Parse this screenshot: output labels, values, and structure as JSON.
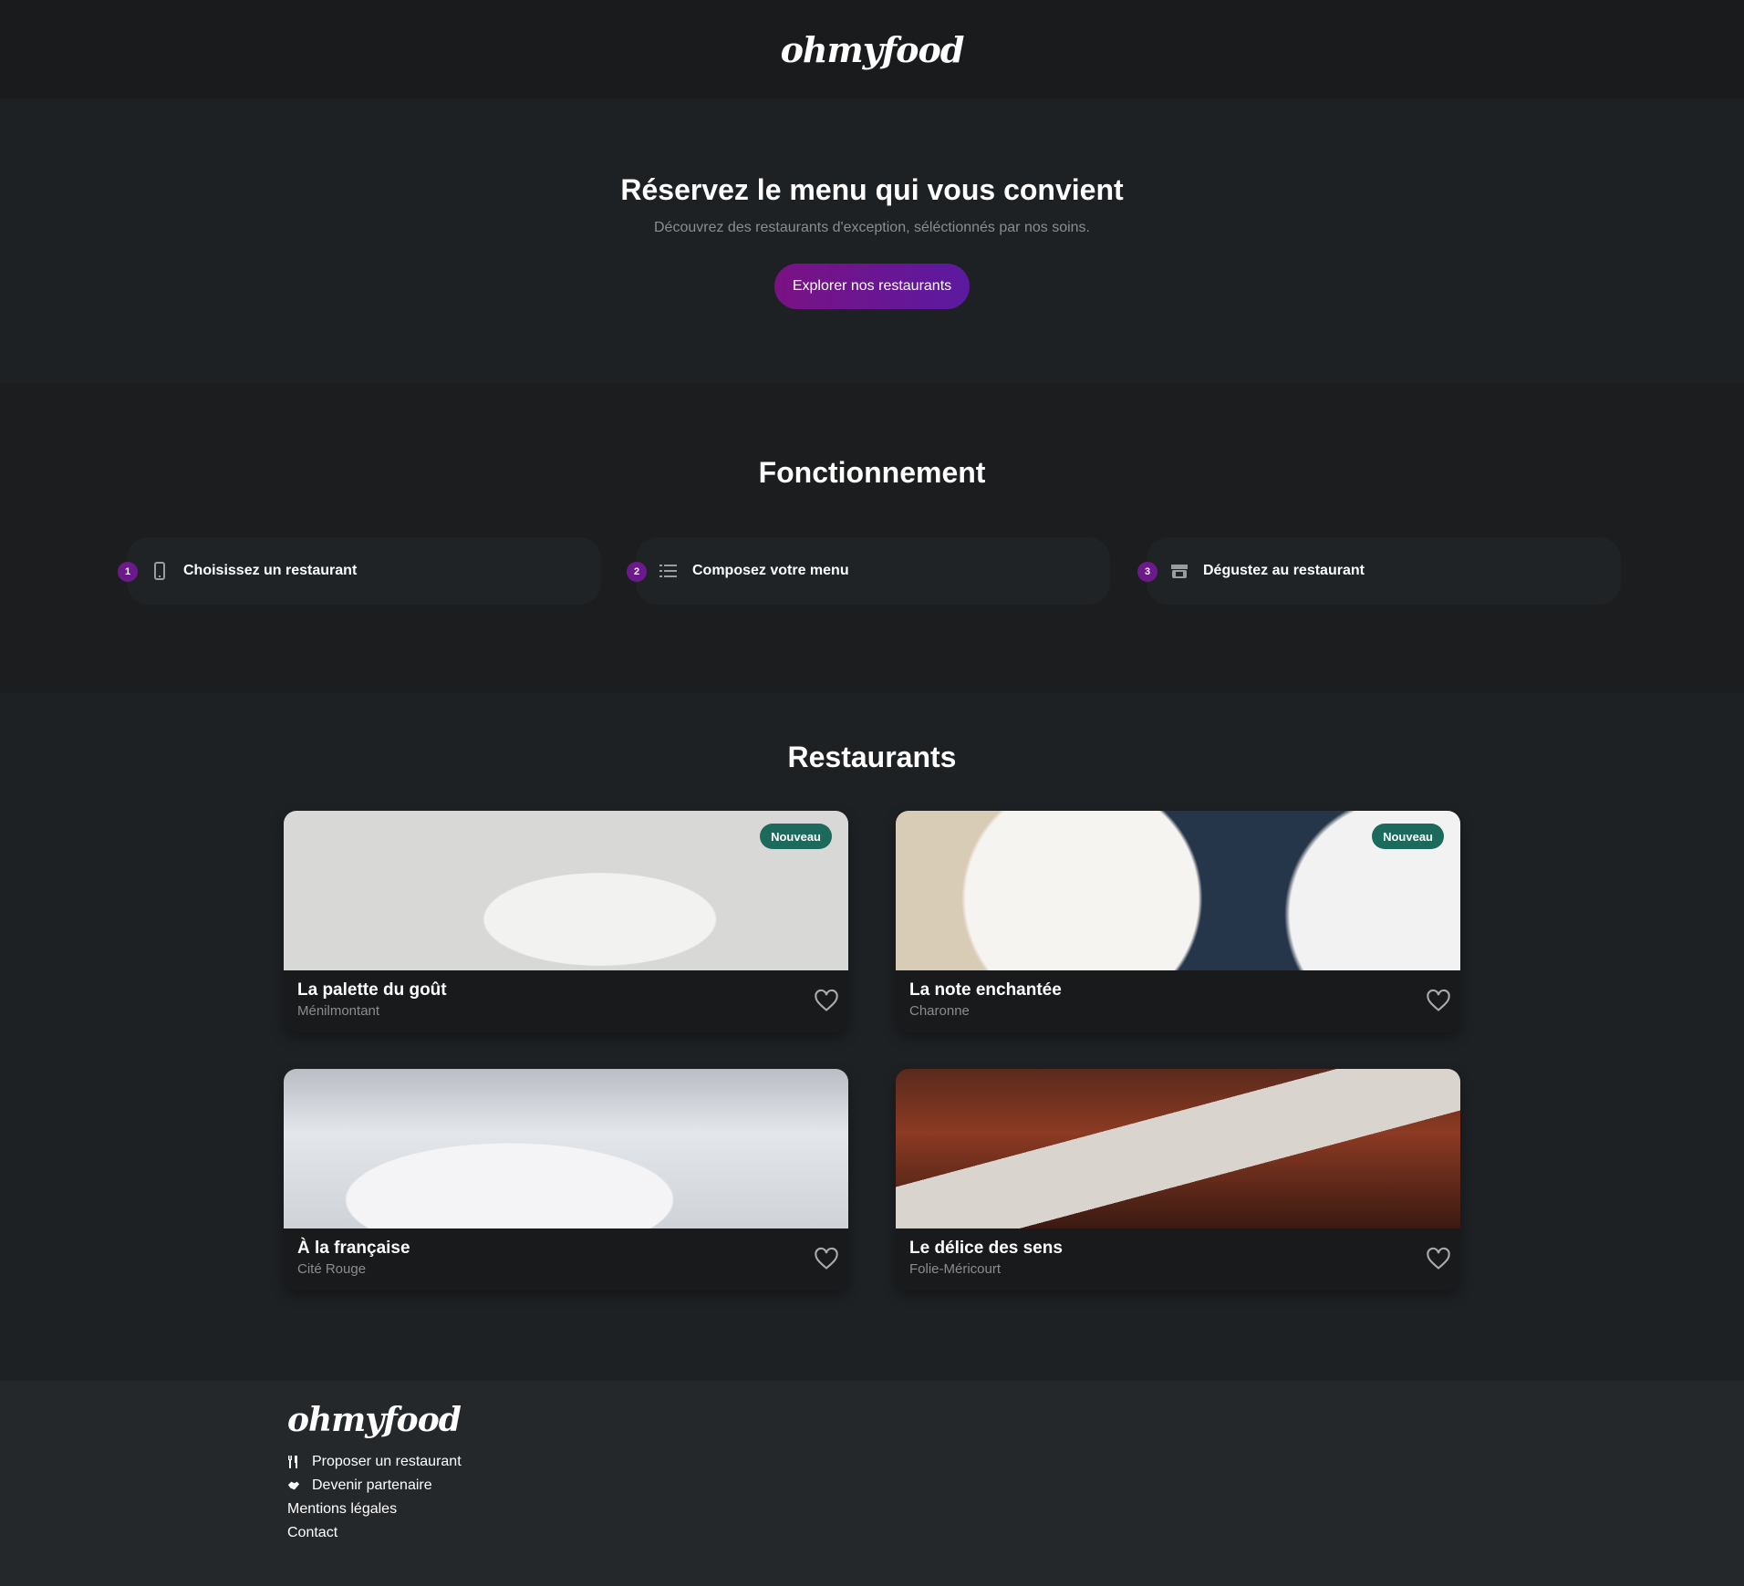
{
  "header": {
    "logo": "ohmyfood"
  },
  "hero": {
    "title": "Réservez le menu qui vous convient",
    "subtitle": "Découvrez des restaurants d'exception, séléctionnés par nos soins.",
    "cta_label": "Explorer nos restaurants"
  },
  "how": {
    "title": "Fonctionnement",
    "steps": [
      {
        "number": "1",
        "icon": "phone-icon",
        "label": "Choisissez un restaurant"
      },
      {
        "number": "2",
        "icon": "list-icon",
        "label": "Composez votre menu"
      },
      {
        "number": "3",
        "icon": "store-icon",
        "label": "Dégustez au restaurant"
      }
    ]
  },
  "restaurants": {
    "title": "Restaurants",
    "items": [
      {
        "name": "La palette du goût",
        "location": "Ménilmontant",
        "badge": "Nouveau"
      },
      {
        "name": "La note enchantée",
        "location": "Charonne",
        "badge": "Nouveau"
      },
      {
        "name": "À la française",
        "location": "Cité Rouge",
        "badge": ""
      },
      {
        "name": "Le délice des sens",
        "location": "Folie-Méricourt",
        "badge": ""
      }
    ]
  },
  "footer": {
    "logo": "ohmyfood",
    "links": [
      {
        "label": "Proposer un restaurant",
        "icon": "utensils-icon"
      },
      {
        "label": "Devenir partenaire",
        "icon": "handshake-icon"
      },
      {
        "label": "Mentions légales",
        "icon": ""
      },
      {
        "label": "Contact",
        "icon": ""
      }
    ]
  },
  "colors": {
    "accent": "#6c1a8b",
    "badge": "#1c6a5c"
  }
}
